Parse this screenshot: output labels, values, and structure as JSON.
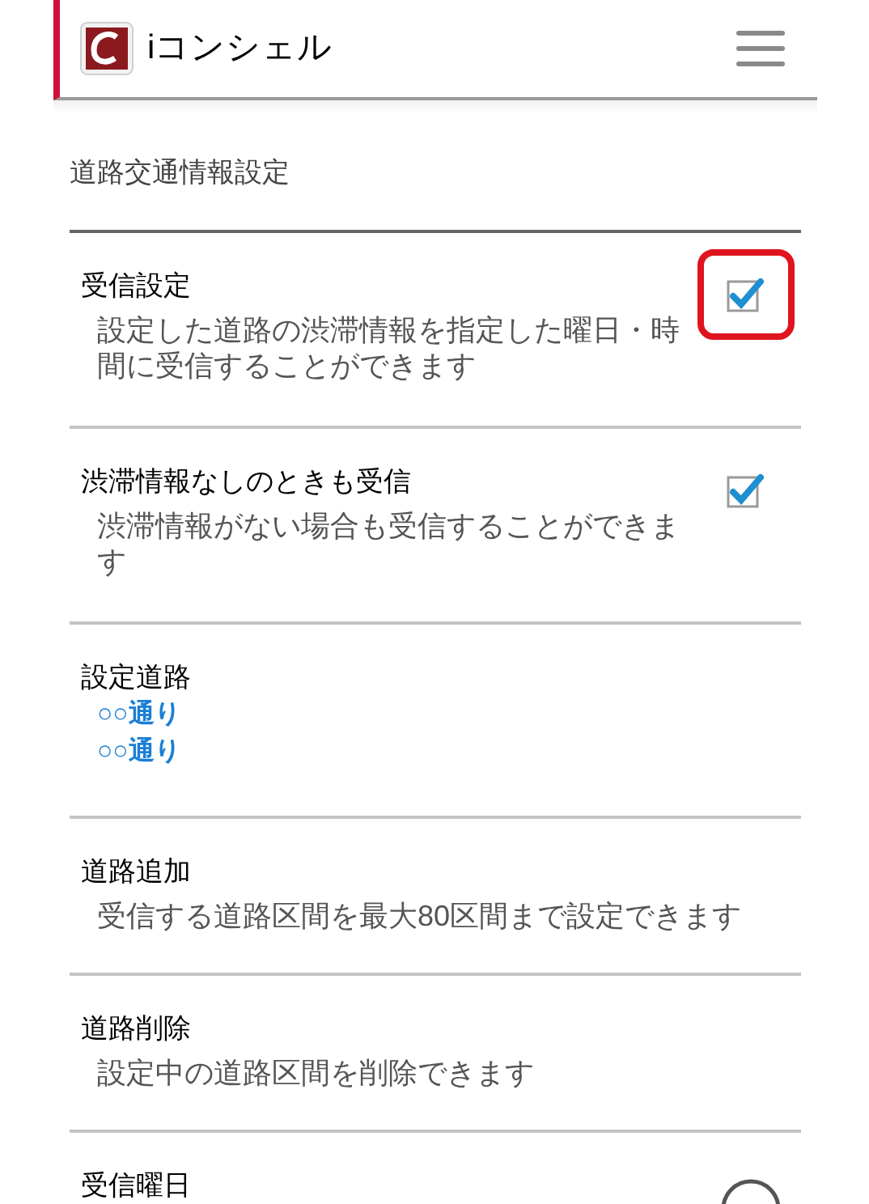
{
  "header": {
    "app_name": "iコンシェル"
  },
  "section_title": "道路交通情報設定",
  "rows": [
    {
      "kind": "checkbox",
      "title": "受信設定",
      "description": "設定した道路の渋滞情報を指定した曜日・時間に受信することができます",
      "checked": true,
      "highlighted": true
    },
    {
      "kind": "checkbox",
      "title": "渋滞情報なしのときも受信",
      "description": "渋滞情報がない場合も受信することができます",
      "checked": true,
      "highlighted": false
    },
    {
      "kind": "roads",
      "title": "設定道路",
      "roads": [
        "○○通り",
        "○○通り"
      ]
    },
    {
      "kind": "plain",
      "title": "道路追加",
      "description": "受信する道路区間を最大80区間まで設定できます"
    },
    {
      "kind": "plain",
      "title": "道路削除",
      "description": "設定中の道路区間を削除できます"
    },
    {
      "kind": "circle",
      "title": "受信曜日"
    }
  ]
}
